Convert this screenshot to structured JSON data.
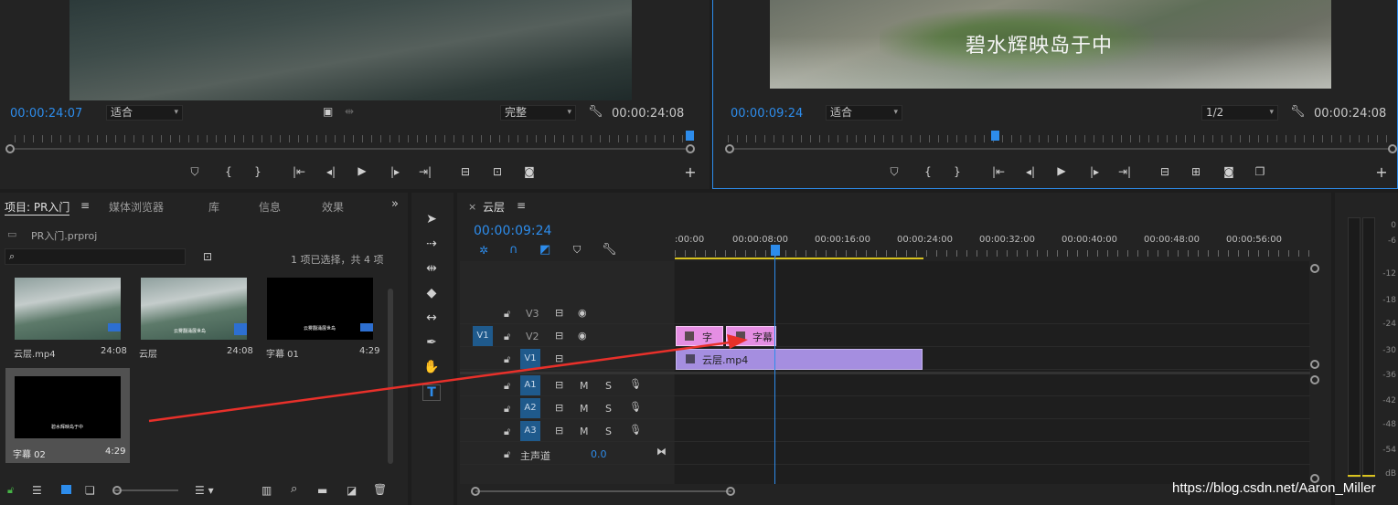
{
  "source_monitor": {
    "timecode_in": "00:00:24:07",
    "fit": "适合",
    "quality": "完整",
    "timecode_out": "00:00:24:08"
  },
  "program_monitor": {
    "caption": "碧水辉映岛于中",
    "timecode_in": "00:00:09:24",
    "fit": "适合",
    "quality": "1/2",
    "timecode_out": "00:00:24:08"
  },
  "project_panel": {
    "tabs": [
      "项目: PR入门",
      "媒体浏览器",
      "库",
      "信息",
      "效果"
    ],
    "file": "PR入门.prproj",
    "selection_info": "1 项已选择，共 4 项",
    "items": [
      {
        "name": "云层.mp4",
        "duration": "24:08"
      },
      {
        "name": "云层",
        "duration": "24:08"
      },
      {
        "name": "字幕 01",
        "duration": "4:29"
      },
      {
        "name": "字幕 02",
        "duration": "4:29"
      }
    ],
    "thumb_caption_2": "云雾翻涌展世岛",
    "thumb_caption_3": "云雾翻涌展世岛",
    "thumb_caption_4": "碧水辉映岛于中"
  },
  "timeline": {
    "title": "云层",
    "timecode": "00:00:09:24",
    "ruler": [
      ":00:00",
      "00:00:08:00",
      "00:00:16:00",
      "00:00:24:00",
      "00:00:32:00",
      "00:00:40:00",
      "00:00:48:00",
      "00:00:56:00"
    ],
    "tracks": {
      "v3": "V3",
      "v2": "V2",
      "v1": "V1",
      "v1_src": "V1",
      "a1": "A1",
      "a2": "A2",
      "a3": "A3",
      "m": "M",
      "s": "S",
      "master": "主声道",
      "master_value": "0.0"
    },
    "clips": {
      "title_a": "字",
      "title_b": "字幕",
      "video": "云层.mp4"
    }
  },
  "audio_meter": {
    "scale": [
      "0",
      "-6",
      "-12",
      "-18",
      "-24",
      "-30",
      "-36",
      "-42",
      "-48",
      "-54",
      "dB"
    ]
  },
  "watermark": "https://blog.csdn.net/Aaron_Miller",
  "colors": {
    "accent_blue": "#2d8ceb",
    "clip_pink": "#e58ee3",
    "clip_purple": "#a58ee0",
    "arrow_red": "#e8302a"
  }
}
